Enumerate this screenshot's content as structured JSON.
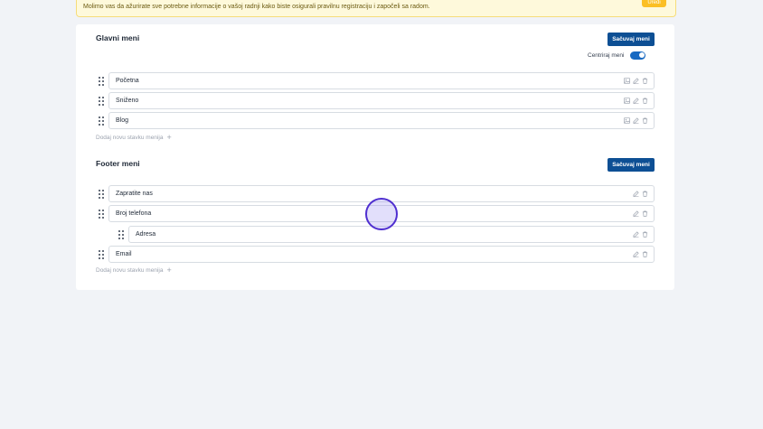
{
  "notice": {
    "text": "Molimo vas da ažurirate sve potrebne informacije o vašoj radnji kako biste osigurali pravilnu registraciju i započeli sa radom.",
    "button": "Uredi"
  },
  "main_menu": {
    "title": "Glavni meni",
    "save_label": "Sačuvaj meni",
    "center_label": "Centriraj meni",
    "center_enabled": true,
    "items": [
      {
        "label": "Početna"
      },
      {
        "label": "Sniženo"
      },
      {
        "label": "Blog"
      }
    ],
    "add_label": "Dodaj novu stavku menija"
  },
  "footer_menu": {
    "title": "Footer meni",
    "save_label": "Sačuvaj meni",
    "items": [
      {
        "label": "Zapratite nas"
      },
      {
        "label": "Broj telefona"
      },
      {
        "label": "Adresa"
      },
      {
        "label": "Email"
      }
    ],
    "add_label": "Dodaj novu stavku menija"
  }
}
